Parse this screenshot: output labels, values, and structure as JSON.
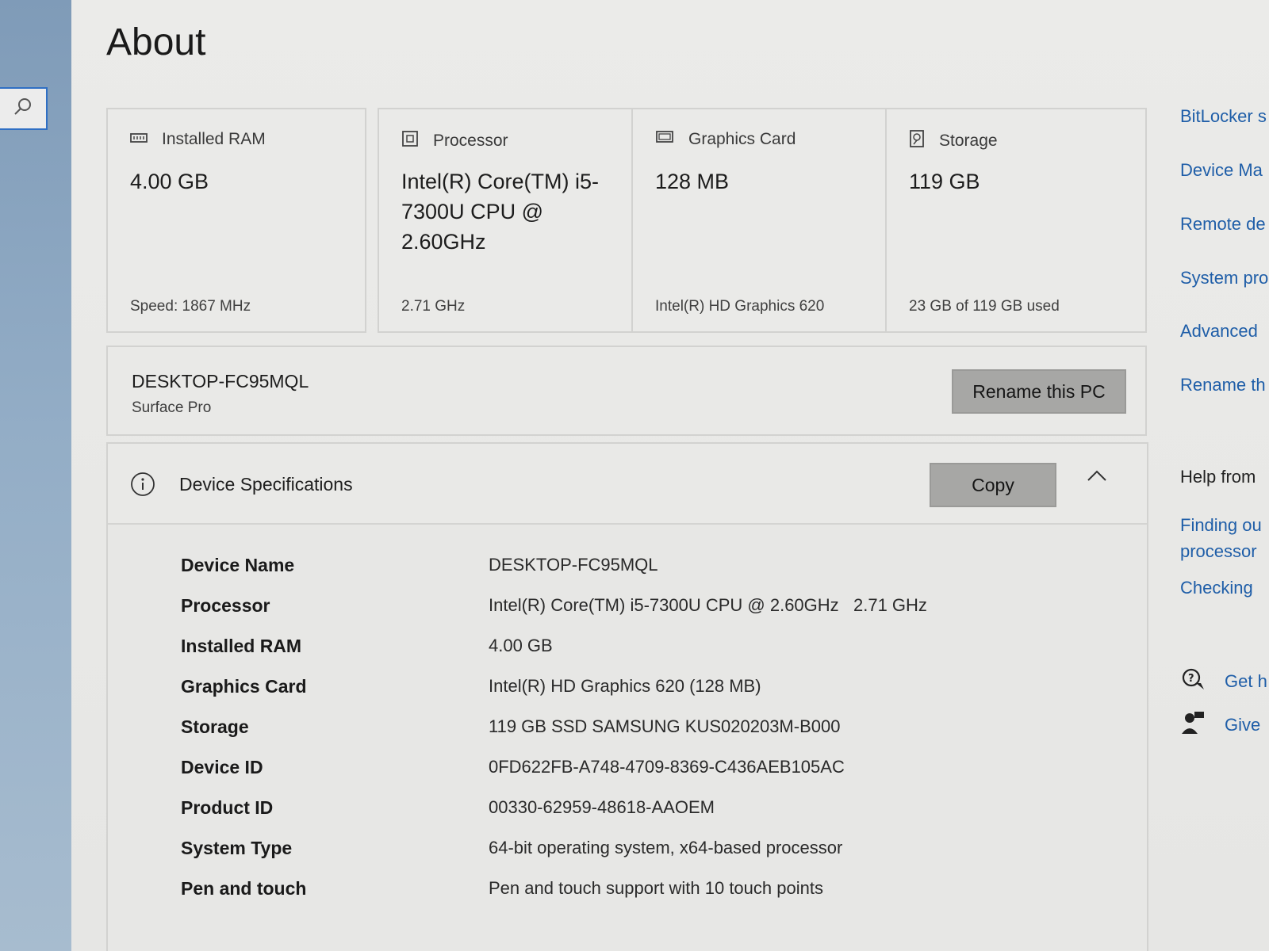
{
  "page": {
    "title": "About"
  },
  "cards": {
    "ram": {
      "label": "Installed RAM",
      "value": "4.00 GB",
      "sub": "Speed: 1867 MHz"
    },
    "processor": {
      "label": "Processor",
      "value": "Intel(R) Core(TM) i5-7300U CPU @ 2.60GHz",
      "sub": "2.71 GHz"
    },
    "graphics": {
      "label": "Graphics Card",
      "value": "128 MB",
      "sub": "Intel(R) HD Graphics 620"
    },
    "storage": {
      "label": "Storage",
      "value": "119 GB",
      "sub": "23 GB of 119 GB used"
    }
  },
  "pc": {
    "name": "DESKTOP-FC95MQL",
    "model": "Surface Pro",
    "rename_label": "Rename this PC"
  },
  "specs": {
    "title": "Device Specifications",
    "copy_label": "Copy",
    "rows": [
      {
        "label": "Device Name",
        "value": "DESKTOP-FC95MQL"
      },
      {
        "label": "Processor",
        "value": "Intel(R) Core(TM) i5-7300U CPU @ 2.60GHz   2.71 GHz"
      },
      {
        "label": "Installed RAM",
        "value": "4.00 GB"
      },
      {
        "label": "Graphics Card",
        "value": "Intel(R) HD Graphics 620 (128 MB)"
      },
      {
        "label": "Storage",
        "value": "119 GB SSD SAMSUNG KUS020203M-B000"
      },
      {
        "label": "Device ID",
        "value": "0FD622FB-A748-4709-8369-C436AEB105AC"
      },
      {
        "label": "Product ID",
        "value": "00330-62959-48618-AAOEM"
      },
      {
        "label": "System Type",
        "value": "64-bit operating system, x64-based processor"
      },
      {
        "label": "Pen and touch",
        "value": "Pen and touch support with 10 touch points"
      }
    ]
  },
  "related": {
    "links": [
      "BitLocker s",
      "Device Ma",
      "Remote de",
      "System pro",
      "Advanced",
      "Rename th"
    ],
    "help_heading": "Help from",
    "help_links": [
      "Finding ou",
      "processor",
      "Checking"
    ],
    "get_help": "Get h",
    "give_feedback": "Give"
  },
  "colors": {
    "link": "#1f5ea8",
    "search_border": "#2f6fc4",
    "button": "#a7a7a5"
  },
  "icons": [
    "search-icon",
    "ram-icon",
    "processor-icon",
    "graphics-card-icon",
    "storage-icon",
    "info-icon",
    "chevron-up-icon",
    "get-help-icon",
    "feedback-icon"
  ]
}
